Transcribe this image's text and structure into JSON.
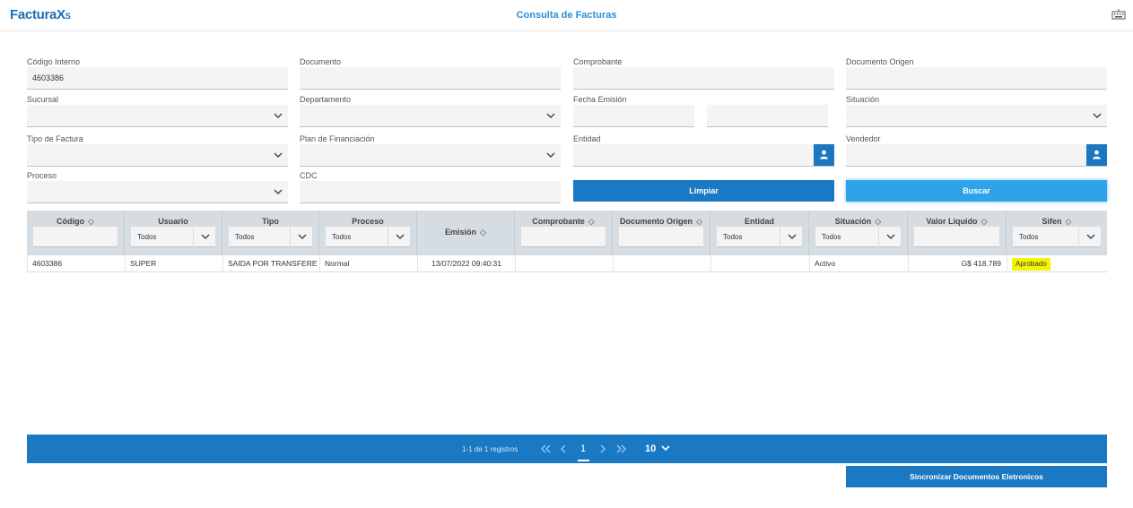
{
  "app": {
    "logo": "Factura",
    "logo_x": "X",
    "logo_sub": "S",
    "title": "Consulta de Facturas"
  },
  "form": {
    "codigo_interno": {
      "label": "Código Interno",
      "value": "4603386"
    },
    "documento": {
      "label": "Documento",
      "value": ""
    },
    "comprobante": {
      "label": "Comprobante",
      "value": ""
    },
    "documento_origen": {
      "label": "Documento Origen",
      "value": ""
    },
    "sucursal": {
      "label": "Sucursal",
      "value": ""
    },
    "departamento": {
      "label": "Departamento",
      "value": ""
    },
    "fecha_emision": {
      "label": "Fecha Emisión",
      "from": "",
      "to": ""
    },
    "situacion": {
      "label": "Situación",
      "value": ""
    },
    "tipo_factura": {
      "label": "Tipo de Factura",
      "value": ""
    },
    "plan_financiacion": {
      "label": "Plan de Financiación",
      "value": ""
    },
    "entidad": {
      "label": "Entidad",
      "value": ""
    },
    "vendedor": {
      "label": "Vendedor",
      "value": ""
    },
    "proceso": {
      "label": "Proceso",
      "value": ""
    },
    "cdc": {
      "label": "CDC",
      "value": ""
    },
    "limpiar_label": "Limpiar",
    "buscar_label": "Buscar"
  },
  "grid": {
    "columns": [
      {
        "key": "codigo",
        "label": "Código",
        "sortable": true,
        "filter": "input"
      },
      {
        "key": "usuario",
        "label": "Usuario",
        "sortable": false,
        "filter": "select",
        "filter_value": "Todos"
      },
      {
        "key": "tipo",
        "label": "Tipo",
        "sortable": false,
        "filter": "select",
        "filter_value": "Todos"
      },
      {
        "key": "proceso",
        "label": "Proceso",
        "sortable": false,
        "filter": "select",
        "filter_value": "Todos"
      },
      {
        "key": "emision",
        "label": "Emisión",
        "sortable": true,
        "filter": "none"
      },
      {
        "key": "comprobante",
        "label": "Comprobante",
        "sortable": true,
        "filter": "input"
      },
      {
        "key": "documento_origen",
        "label": "Documento Origen",
        "sortable": true,
        "filter": "input"
      },
      {
        "key": "entidad",
        "label": "Entidad",
        "sortable": false,
        "filter": "select",
        "filter_value": "Todos"
      },
      {
        "key": "situacion",
        "label": "Situación",
        "sortable": true,
        "filter": "select",
        "filter_value": "Todos"
      },
      {
        "key": "valor_liquido",
        "label": "Valor Liquido",
        "sortable": true,
        "filter": "input"
      },
      {
        "key": "sifen",
        "label": "Sifen",
        "sortable": true,
        "filter": "select",
        "filter_value": "Todos"
      }
    ],
    "rows": [
      {
        "codigo": "4603386",
        "usuario": "SUPER",
        "tipo": "SAIDA POR TRANSFERE",
        "proceso": "Normal",
        "emision": "13/07/2022 09:40:31",
        "comprobante": "",
        "documento_origen": "",
        "entidad": "",
        "situacion": "Activo",
        "valor_liquido": "G$ 418.789",
        "sifen": "Aprobado"
      }
    ]
  },
  "paginator": {
    "info": "1-1 de 1 registros",
    "current_page": "1",
    "rows_per_page": "10"
  },
  "sync_label": "Sincronizar Documentos Eletronicos",
  "colors": {
    "primary": "#1b79c3",
    "accent": "#2da3ea",
    "badge": "#f5f500"
  }
}
